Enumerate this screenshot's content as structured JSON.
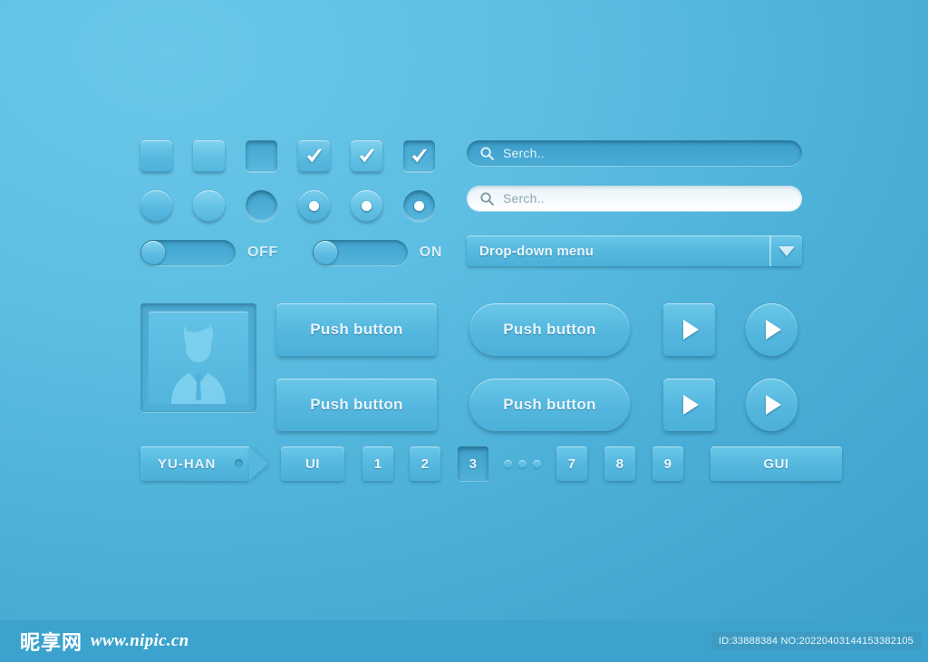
{
  "checkboxes": {
    "items": [
      {
        "state": "normal",
        "checked": false,
        "name": "checkbox-normal"
      },
      {
        "state": "hover",
        "checked": false,
        "name": "checkbox-hover"
      },
      {
        "state": "pressed",
        "checked": false,
        "name": "checkbox-pressed"
      },
      {
        "state": "normal",
        "checked": true,
        "name": "checkbox-checked-normal"
      },
      {
        "state": "hover",
        "checked": true,
        "name": "checkbox-checked-hover"
      },
      {
        "state": "pressed",
        "checked": true,
        "name": "checkbox-checked-pressed"
      }
    ]
  },
  "radios": {
    "items": [
      {
        "state": "normal",
        "selected": false,
        "name": "radio-normal"
      },
      {
        "state": "hover",
        "selected": false,
        "name": "radio-hover"
      },
      {
        "state": "pressed",
        "selected": false,
        "name": "radio-pressed"
      },
      {
        "state": "normal",
        "selected": true,
        "name": "radio-selected-normal"
      },
      {
        "state": "hover",
        "selected": true,
        "name": "radio-selected-hover"
      },
      {
        "state": "pressed",
        "selected": true,
        "name": "radio-selected-pressed"
      }
    ]
  },
  "toggles": [
    {
      "label": "OFF",
      "value": "off"
    },
    {
      "label": "ON",
      "value": "on"
    }
  ],
  "search": {
    "dark": {
      "placeholder": "Serch..",
      "value": "",
      "icon": "search-icon"
    },
    "light": {
      "placeholder": "Serch..",
      "value": "",
      "icon": "search-icon"
    }
  },
  "dropdown": {
    "label": "Drop-down menu",
    "arrow_icon": "chevron-down-icon",
    "selected": "Drop-down menu"
  },
  "avatar": {
    "alt": "user-silhouette-placeholder"
  },
  "buttons": {
    "push_rect_1": "Push button",
    "push_round_1": "Push button",
    "push_rect_2": "Push button",
    "push_round_2": "Push button",
    "play_icon": "play-icon"
  },
  "tag": {
    "label": "YU-HAN"
  },
  "pagination": {
    "items": [
      {
        "label": "UI",
        "type": "wide",
        "active": false
      },
      {
        "label": "1",
        "type": "num",
        "active": false
      },
      {
        "label": "2",
        "type": "num",
        "active": false
      },
      {
        "label": "3",
        "type": "num",
        "active": true
      },
      {
        "label": "…",
        "type": "dots",
        "active": false
      },
      {
        "label": "7",
        "type": "num",
        "active": false
      },
      {
        "label": "8",
        "type": "num",
        "active": false
      },
      {
        "label": "9",
        "type": "num",
        "active": false
      },
      {
        "label": "GUI",
        "type": "gui",
        "active": false
      }
    ]
  },
  "footer": {
    "watermark_cn": "昵享网",
    "watermark_url": "www.nipic.cn",
    "id_text": "ID:33888384 NO:20220403144153382105"
  },
  "colors": {
    "bg_light": "#6ac7e8",
    "bg_dark": "#3ca0cc",
    "control_light": "#6ac7e9",
    "control_dark": "#4bb0d9",
    "text": "#e6f5fc",
    "footer_bar": "#3ba3cd"
  }
}
